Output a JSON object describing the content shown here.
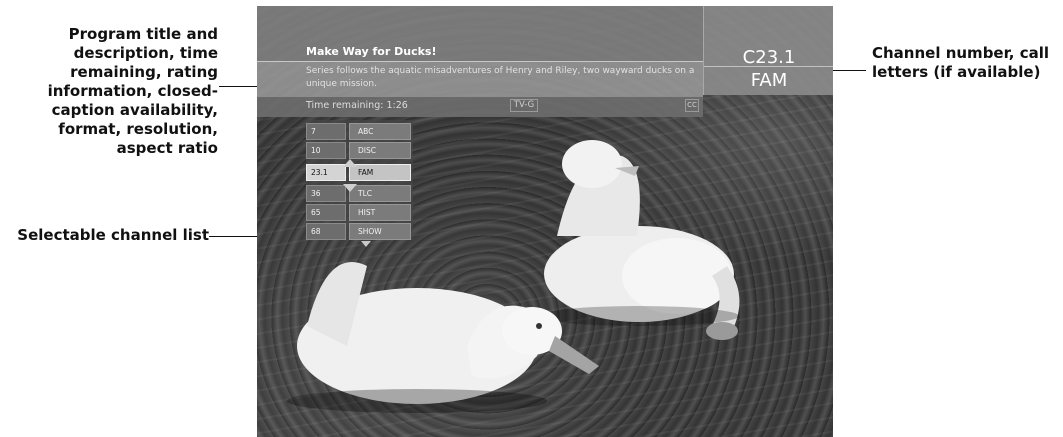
{
  "callouts": {
    "program_info": [
      "Program title and",
      "description, time",
      "remaining, rating",
      "information, closed-",
      "caption availability,",
      "format, resolution,",
      "aspect ratio"
    ],
    "channel_list": "Selectable channel list",
    "channel_id": [
      "Channel number, call",
      "letters (if available)"
    ]
  },
  "banner": {
    "title": "Make Way for Ducks!",
    "description": "Series follows the aquatic misadventures of Henry and Riley, two wayward ducks on a unique mission.",
    "time_remaining": "Time remaining: 1:26",
    "rating": "TV-G",
    "cc": "CC"
  },
  "channel": {
    "number": "C23.1",
    "call_letters": "FAM"
  },
  "channel_list": [
    {
      "number": "7",
      "call": "ABC",
      "selected": false
    },
    {
      "number": "10",
      "call": "DISC",
      "selected": false
    },
    {
      "number": "23.1",
      "call": "FAM",
      "selected": true
    },
    {
      "number": "36",
      "call": "TLC",
      "selected": false
    },
    {
      "number": "65",
      "call": "HIST",
      "selected": false
    },
    {
      "number": "68",
      "call": "SHOW",
      "selected": false
    }
  ],
  "colors": {
    "banner": "#828282",
    "selected_row": "#d4d4d4"
  }
}
